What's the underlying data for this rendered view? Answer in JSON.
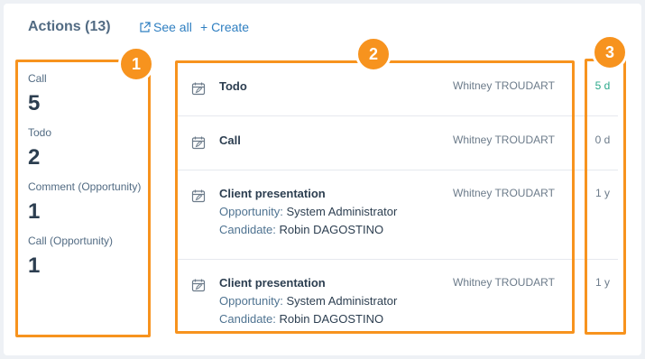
{
  "header": {
    "title": "Actions (13)",
    "see_all": "See all",
    "create": "+ Create"
  },
  "stats": [
    {
      "label": "Call",
      "value": "5"
    },
    {
      "label": "Todo",
      "value": "2"
    },
    {
      "label": "Comment (Opportunity)",
      "value": "1"
    },
    {
      "label": "Call (Opportunity)",
      "value": "1"
    }
  ],
  "actions": [
    {
      "title": "Todo",
      "owner": "Whitney TROUDART",
      "time": "5 d"
    },
    {
      "title": "Call",
      "owner": "Whitney TROUDART",
      "time": "0 d"
    },
    {
      "title": "Client presentation",
      "opportunity_key": "Opportunity:",
      "opportunity": "System Administrator",
      "candidate_key": "Candidate:",
      "candidate": "Robin DAGOSTINO",
      "owner": "Whitney TROUDART",
      "time": "1 y"
    },
    {
      "title": "Client presentation",
      "opportunity_key": "Opportunity:",
      "opportunity": "System Administrator",
      "candidate_key": "Candidate:",
      "candidate": "Robin DAGOSTINO",
      "owner": "Whitney TROUDART",
      "time": "1 y"
    }
  ],
  "badges": [
    "1",
    "2",
    "3"
  ],
  "colors": {
    "highlight": "#f7931e",
    "link": "#2f7fc1",
    "recent_time": "#2aa88a"
  }
}
